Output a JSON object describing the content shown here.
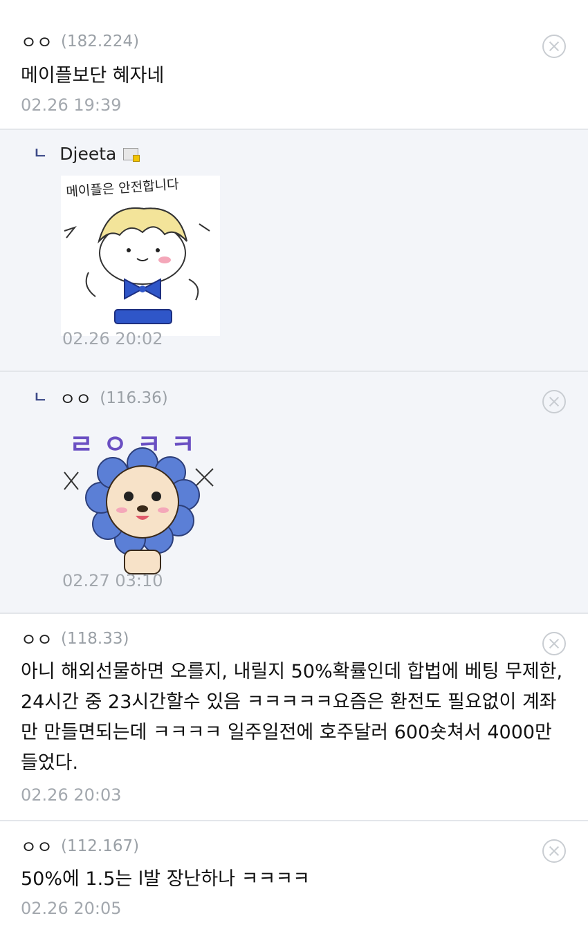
{
  "comments": [
    {
      "nick": "ㅇㅇ",
      "ip": "(182.224)",
      "text": "메이플보단 혜자네",
      "date": "02.26 19:39"
    },
    {
      "reply_mark": "ㄴ",
      "nick": "Djeeta",
      "sticker_text": "메이플은 안전합니다",
      "date": "02.26 20:02"
    },
    {
      "reply_mark": "ㄴ",
      "nick": "ㅇㅇ",
      "ip": "(116.36)",
      "sticker_text": "ㄹㅇㅋㅋ",
      "date": "02.27 03:10"
    },
    {
      "nick": "ㅇㅇ",
      "ip": "(118.33)",
      "text": "아니 해외선물하면 오를지, 내릴지 50%확률인데 합법에 베팅 무제한, 24시간 중 23시간할수 있음 ㅋㅋㅋㅋㅋ요즘은 환전도 필요없이 계좌만 만들면되는데 ㅋㅋㅋㅋ 일주일전에 호주달러 600숏쳐서 4000만들었다.",
      "date": "02.26 20:03"
    },
    {
      "nick": "ㅇㅇ",
      "ip": "(112.167)",
      "text": "50%에 1.5는   l발 장난하나 ㅋㅋㅋㅋ",
      "date": "02.26 20:05"
    }
  ],
  "icons": {
    "delete": "close-circle-icon",
    "member": "gallery-member-icon"
  },
  "colors": {
    "reply_bg": "#f3f5f9",
    "divider": "#e3e6ea",
    "reply_mark": "#3d4a88",
    "meta": "#a3a8ae",
    "sticker_purple": "#6a4fc2",
    "flower_blue": "#5b7fd6"
  }
}
